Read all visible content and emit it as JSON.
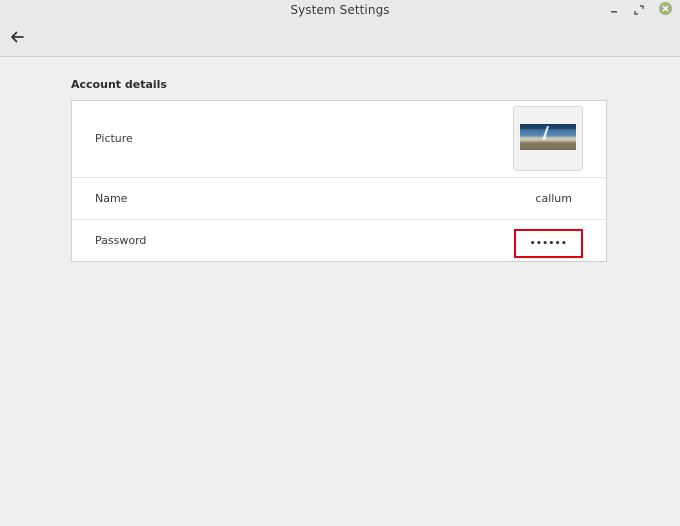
{
  "window": {
    "title": "System Settings",
    "controls": [
      "minimize-icon",
      "maximize-icon",
      "close-icon"
    ],
    "close_color": "#9ab87a"
  },
  "nav": {
    "back_icon": "arrow-left-icon"
  },
  "account": {
    "section_title": "Account details",
    "picture": {
      "label": "Picture",
      "thumbnail": "landscape-thumbnail"
    },
    "name": {
      "label": "Name",
      "value": "callum"
    },
    "password": {
      "label": "Password",
      "value": "••••••",
      "highlight_color": "#e0000f"
    }
  }
}
